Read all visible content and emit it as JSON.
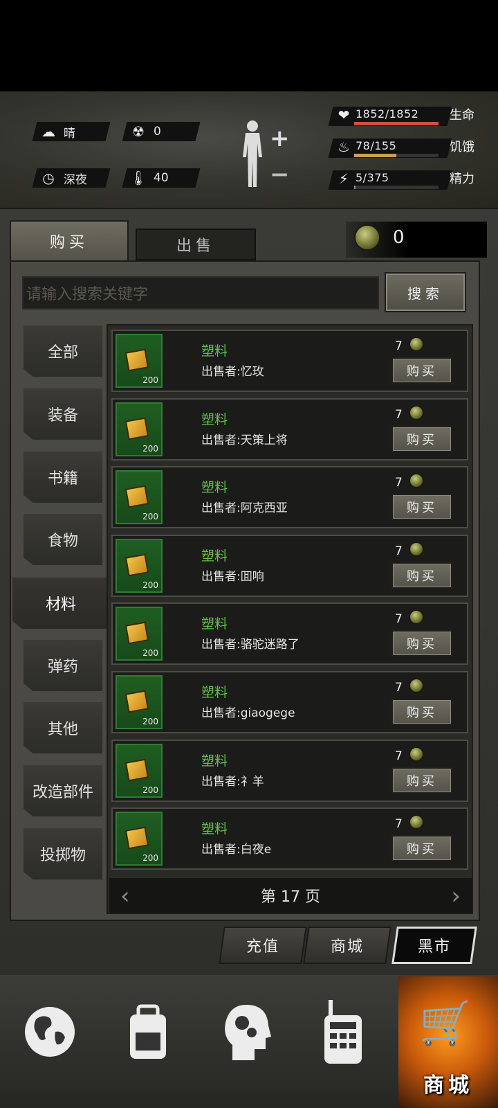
{
  "status": {
    "weather": "晴",
    "radiation": "0",
    "time_of_day": "深夜",
    "temperature": "40",
    "health": {
      "value": "1852/1852",
      "label": "生命",
      "fraction": 1.0,
      "color": "#d0503c"
    },
    "hunger": {
      "value": "78/155",
      "label": "饥饿",
      "fraction": 0.503,
      "color": "#c9a24a"
    },
    "energy": {
      "value": "5/375",
      "label": "精力",
      "fraction": 0.013,
      "color": "#6e8fbf"
    },
    "body_plus": "+",
    "body_minus": "−"
  },
  "tabs": {
    "buy": "购买",
    "sell": "出售"
  },
  "currency": {
    "count": "0"
  },
  "search": {
    "placeholder": "请输入搜索关键字",
    "button": "搜索"
  },
  "categories": [
    "全部",
    "装备",
    "书籍",
    "食物",
    "材料",
    "弹药",
    "其他",
    "改造部件",
    "投掷物"
  ],
  "active_category": "材料",
  "items": [
    {
      "name": "塑料",
      "seller": "出售者:忆玫",
      "qty": "200",
      "price": "7",
      "buy": "购买"
    },
    {
      "name": "塑料",
      "seller": "出售者:天策上将",
      "qty": "200",
      "price": "7",
      "buy": "购买"
    },
    {
      "name": "塑料",
      "seller": "出售者:阿克西亚",
      "qty": "200",
      "price": "7",
      "buy": "购买"
    },
    {
      "name": "塑料",
      "seller": "出售者:囬响",
      "qty": "200",
      "price": "7",
      "buy": "购买"
    },
    {
      "name": "塑料",
      "seller": "出售者:骆驼迷路了",
      "qty": "200",
      "price": "7",
      "buy": "购买"
    },
    {
      "name": "塑料",
      "seller": "出售者:giaogege",
      "qty": "200",
      "price": "7",
      "buy": "购买"
    },
    {
      "name": "塑料",
      "seller": "出售者:礻羊",
      "qty": "200",
      "price": "7",
      "buy": "购买"
    },
    {
      "name": "塑料",
      "seller": "出售者:白夜e",
      "qty": "200",
      "price": "7",
      "buy": "购买"
    }
  ],
  "pager": {
    "text": "第 17 页",
    "prev": "‹",
    "next": "›"
  },
  "market_tabs": {
    "recharge": "充值",
    "store": "商城",
    "black_market": "黑市"
  },
  "nav": {
    "shop_label": "商城"
  }
}
